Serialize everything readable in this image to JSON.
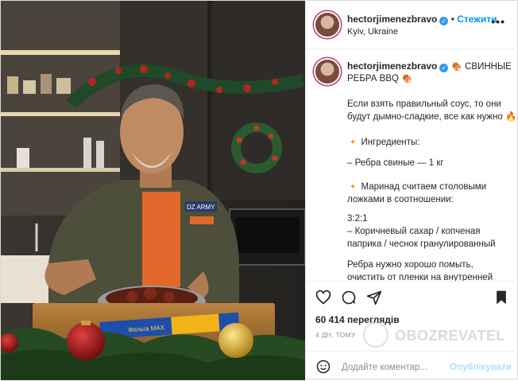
{
  "post": {
    "username": "hectorjimenezbravo",
    "follow_label": "Стежити",
    "location": "Kyiv, Ukraine",
    "more_icon": "ellipsis-icon",
    "caption": {
      "title_line1": "🍖 СВИННЫЕ",
      "title_line2": "РЕБРА BBQ 🍖",
      "lines": [
        "Если взять правильный соус, то они",
        "будут дымно-сладкие, все как нужно 🔥",
        "",
        "🔸 Ингредиенты:",
        "",
        "– Ребра свиные — 1 кг",
        "",
        "🔸 Маринад считаем столовыми",
        "ложками в соотношении:",
        "",
        "3:2:1",
        "– Коричневый сахар / копченая",
        "паприка / чеснок гранулированный",
        "",
        "Ребра нужно хорошо помыть,",
        "очистить от пленки на внутренней"
      ]
    },
    "views": "60 414 переглядів",
    "time_ago": "4 ДН. ТОМУ",
    "comment_placeholder": "Додайте коментар...",
    "publish_label": "Опублікувати",
    "watermark": "OBOZREVATEL",
    "photo_product_label": "Фольга MAX",
    "photo_apron_label": "DZ ARMY"
  },
  "colors": {
    "accent": "#0095f6",
    "verified": "#3897f0",
    "muted": "#8e8e8e"
  },
  "icons": [
    "heart-icon",
    "comment-icon",
    "share-icon",
    "bookmark-icon",
    "emoji-icon",
    "verified-icon"
  ]
}
